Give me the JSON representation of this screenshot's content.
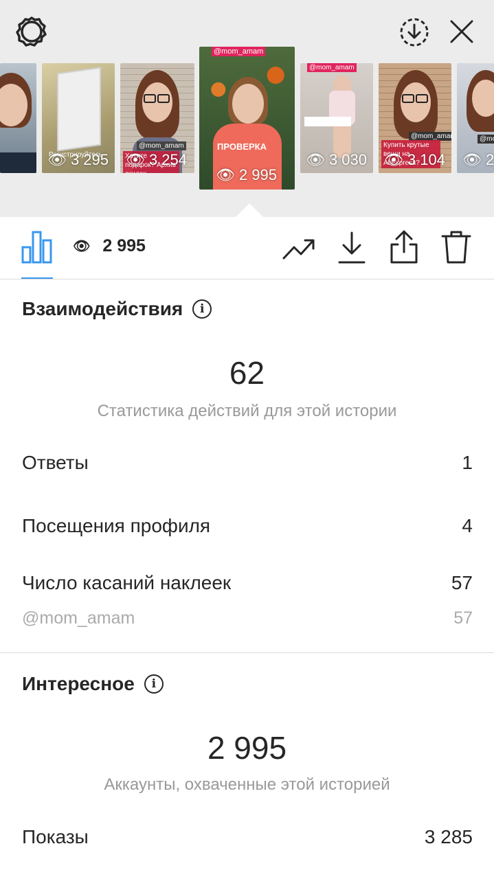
{
  "stories": [
    {
      "views": "3 295",
      "caption": "Регистрируйтесь",
      "tag": ""
    },
    {
      "views": "3 254",
      "caption": "Хотите подарок? Архив скидок",
      "tag": "@mom_amam"
    },
    {
      "views": "2 995",
      "caption": "ПРОВЕРКА",
      "tag": "@mom_amam"
    },
    {
      "views": "3 030",
      "caption": "",
      "tag": "@mom_amam"
    },
    {
      "views": "3 104",
      "caption": "Купить крутые вещи на AliExpress?",
      "tag": "@mom_amam"
    },
    {
      "views": "2",
      "caption": "",
      "tag": "@mom"
    }
  ],
  "toolbar": {
    "views": "2 995"
  },
  "interactions": {
    "title": "Взаимодействия",
    "total": "62",
    "subtitle": "Статистика действий для этой истории",
    "rows": [
      {
        "label": "Ответы",
        "value": "1"
      },
      {
        "label": "Посещения профиля",
        "value": "4"
      },
      {
        "label": "Число касаний наклеек",
        "value": "57"
      }
    ],
    "sticker": {
      "label": "@mom_amam",
      "value": "57"
    }
  },
  "discovery": {
    "title": "Интересное",
    "total": "2 995",
    "subtitle": "Аккаунты, охваченные этой историей",
    "rows": [
      {
        "label": "Показы",
        "value": "3 285"
      }
    ]
  },
  "colors": {
    "accent": "#3897f0",
    "tag": "#e0245e"
  },
  "icons": [
    "settings-gear-icon",
    "download-circle-icon",
    "close-icon",
    "bar-chart-icon",
    "eye-icon",
    "trend-icon",
    "download-icon",
    "share-icon",
    "trash-icon",
    "info-icon"
  ]
}
